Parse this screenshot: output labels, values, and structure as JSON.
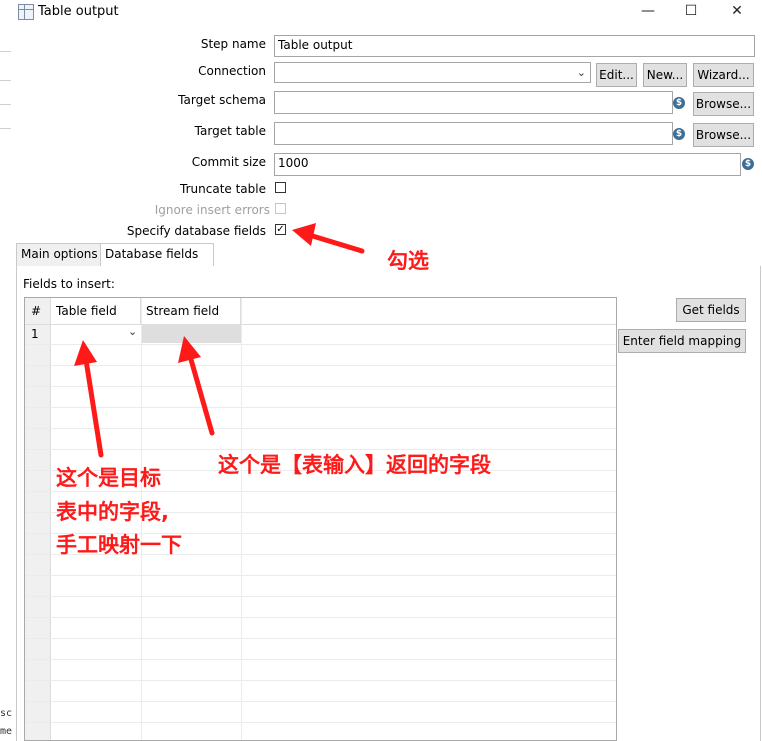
{
  "window": {
    "title": "Table output",
    "minimize_glyph": "—",
    "maximize_glyph": "☐",
    "close_glyph": "✕"
  },
  "background_window_text": [
    "sc",
    "me"
  ],
  "form": {
    "step_name_label": "Step name",
    "step_name_value": "Table output",
    "connection_label": "Connection",
    "connection_value": "",
    "edit_button": "Edit...",
    "new_button": "New...",
    "wizard_button": "Wizard...",
    "target_schema_label": "Target schema",
    "target_schema_value": "",
    "browse_label": "Browse...",
    "target_table_label": "Target table",
    "target_table_value": "",
    "commit_size_label": "Commit size",
    "commit_size_value": "1000",
    "truncate_table_label": "Truncate table",
    "truncate_table_checked": false,
    "ignore_insert_errors_label": "Ignore insert errors",
    "ignore_insert_errors_enabled": false,
    "specify_fields_label": "Specify database fields",
    "specify_fields_checked": true
  },
  "tabs": [
    {
      "label": "Main options",
      "active": false
    },
    {
      "label": "Database fields",
      "active": true
    }
  ],
  "fields_panel": {
    "fields_to_insert_label": "Fields to insert:",
    "columns": [
      "#",
      "Table field",
      "Stream field"
    ],
    "rows": [
      {
        "num": "1",
        "table_field": "",
        "stream_field": ""
      }
    ],
    "get_fields_button": "Get fields",
    "enter_mapping_button": "Enter field mapping"
  },
  "annotations": {
    "check_note": "勾选",
    "stream_note": "这个是【表输入】返回的字段",
    "table_note_lines": [
      "这个是目标",
      "表中的字段,",
      "手工映射一下"
    ],
    "color": "#ff1a1a"
  },
  "colors": {
    "field_border": "#a5a5a5",
    "button_bg": "#e1e1e1",
    "variable_icon": "#3c6e96"
  },
  "icons": {
    "app": "table-output-icon",
    "variable": "dollar-variable-icon",
    "dropdown": "chevron-down-icon"
  }
}
